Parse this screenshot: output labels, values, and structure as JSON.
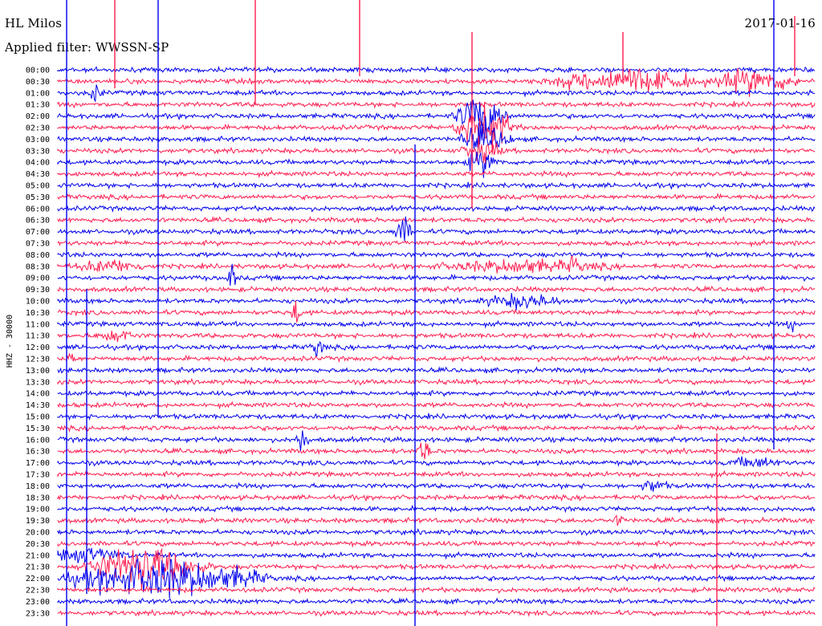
{
  "header": {
    "station": "HL Milos",
    "filter": "Applied filter: WWSSN-SP",
    "date": "2017-01-16"
  },
  "colors": {
    "trace_a": "#0000ee",
    "trace_b": "#ff1c4f",
    "background": "#ffffff"
  },
  "chart_data": {
    "type": "line",
    "title": "HL Milos",
    "ylabel": "HHZ - 30000",
    "tick_labels": [
      "00:00",
      "00:30",
      "01:00",
      "01:30",
      "02:00",
      "02:30",
      "03:00",
      "03:30",
      "04:00",
      "04:30",
      "05:00",
      "05:30",
      "06:00",
      "06:30",
      "07:00",
      "07:30",
      "08:00",
      "08:30",
      "09:00",
      "09:30",
      "10:00",
      "10:30",
      "11:00",
      "11:30",
      "12:00",
      "12:30",
      "13:00",
      "13:30",
      "14:00",
      "14:30",
      "15:00",
      "15:30",
      "16:00",
      "16:30",
      "17:00",
      "17:30",
      "18:00",
      "18:30",
      "19:00",
      "19:30",
      "20:00",
      "20:30",
      "21:00",
      "21:30",
      "22:00",
      "22:30",
      "23:00",
      "23:30"
    ],
    "series": [
      {
        "color": "blue",
        "rows": "even (00:00, 01:00, ...)"
      },
      {
        "color": "red",
        "rows": "odd (00:30, 01:30, ...)"
      }
    ],
    "grid": false,
    "legend": "none"
  }
}
